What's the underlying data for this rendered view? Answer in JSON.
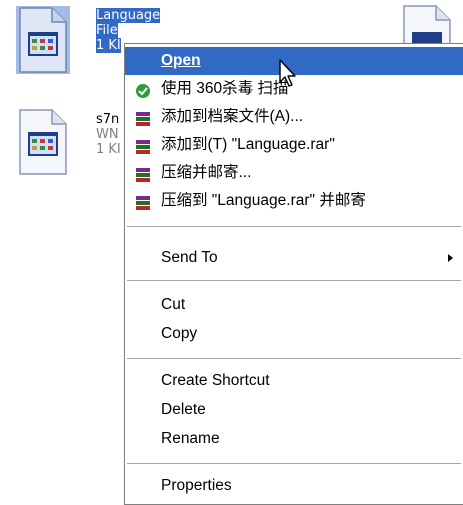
{
  "files": [
    {
      "name": "Language",
      "type_fragment": "File",
      "size_fragment": "1 KI",
      "selected": true,
      "icon": "text-document-icon"
    },
    {
      "name": "s7n",
      "type_fragment": "WN",
      "size_fragment": "1 KI",
      "selected": false,
      "icon": "text-document-icon"
    }
  ],
  "menu": {
    "open": "Open",
    "scan_360": "使用 360杀毒 扫描",
    "add_archive": "添加到档案文件(A)...",
    "add_to_rar": "添加到(T) \"Language.rar\"",
    "compress_mail": "压缩并邮寄...",
    "compress_rar_mail": "压缩到 \"Language.rar\" 并邮寄",
    "send_to": "Send To",
    "cut": "Cut",
    "copy": "Copy",
    "create_shortcut": "Create Shortcut",
    "delete": "Delete",
    "rename": "Rename",
    "properties": "Properties"
  },
  "colors": {
    "highlight": "#316ac5",
    "menu_bg": "#ffffff",
    "separator": "#a6a6a6"
  },
  "icons": {
    "scan": "shield-icon",
    "winrar": "winrar-books-icon",
    "submenu": "submenu-arrow-icon",
    "cursor": "mouse-pointer-icon"
  }
}
